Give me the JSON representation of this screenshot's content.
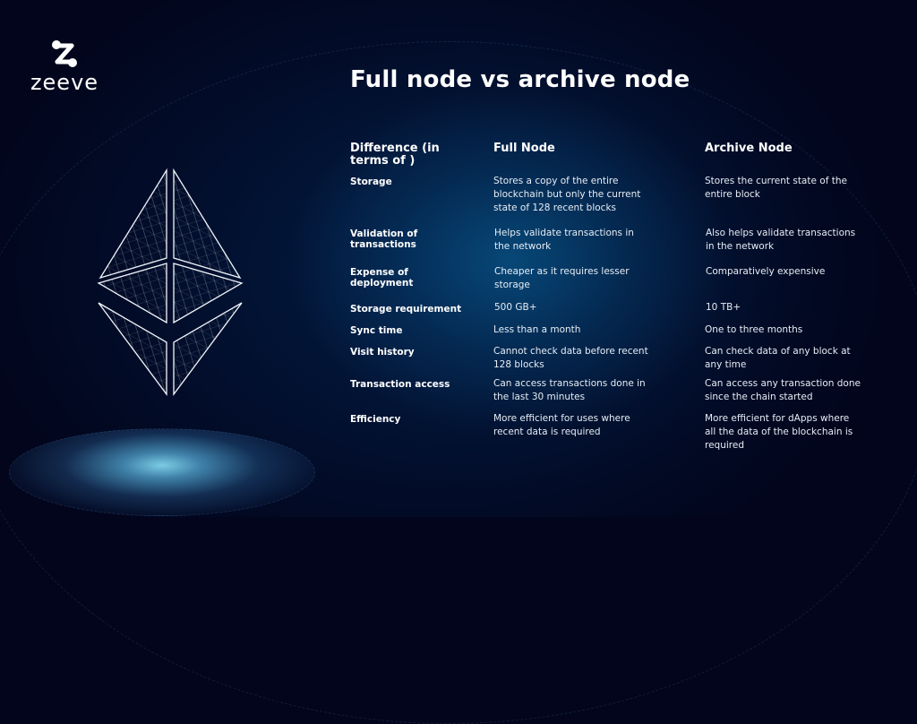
{
  "brand": {
    "logo_icon": "zeeve-logo-icon",
    "name": "zeeve"
  },
  "slide": {
    "title": "Full node vs archive node",
    "illustration": "ethereum-diamond-icon"
  },
  "table": {
    "headers": [
      "Difference (in terms of )",
      "Full Node",
      "Archive Node"
    ],
    "rows": [
      {
        "label": "Storage",
        "full": "Stores a copy of the entire blockchain but only the current state of 128 recent blocks",
        "archive": "Stores the current state of the entire block"
      },
      {
        "label": "Validation of transactions",
        "full": "Helps validate transactions in the network",
        "archive": "Also helps validate transactions in the network"
      },
      {
        "label": "Expense of deployment",
        "full": "Cheaper as it requires lesser storage",
        "archive": "Comparatively expensive"
      },
      {
        "label": "Storage requirement",
        "full": "500 GB+",
        "archive": "10 TB+"
      },
      {
        "label": "Sync time",
        "full": "Less than a month",
        "archive": "One to three months"
      },
      {
        "label": "Visit history",
        "full": "Cannot check data before recent 128 blocks",
        "archive": "Can check data of any block at any time"
      },
      {
        "label": "Transaction access",
        "full": "Can access transactions done in the last 30 minutes",
        "archive": "Can access any transaction done since the chain started"
      },
      {
        "label": "Efficiency",
        "full": "More efficient for uses where recent data is required",
        "archive": "More efficient for dApps where all the data of the blockchain is required"
      }
    ]
  }
}
